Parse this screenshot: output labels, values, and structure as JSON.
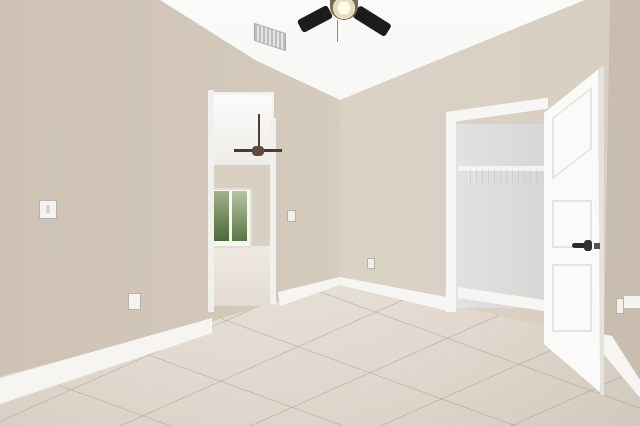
{
  "scene": {
    "description_text": "",
    "caption": ""
  },
  "colors": {
    "wall": "#d8cfc3",
    "ceiling": "#f4f2ee",
    "floor": "#e1d9cf",
    "trim": "#f6f5f2",
    "fan_blades": "#1c1c1c"
  },
  "icons": {
    "ceiling_fan": "ceiling-fan-icon",
    "vent": "air-vent-icon",
    "door_handle": "door-handle-icon"
  }
}
